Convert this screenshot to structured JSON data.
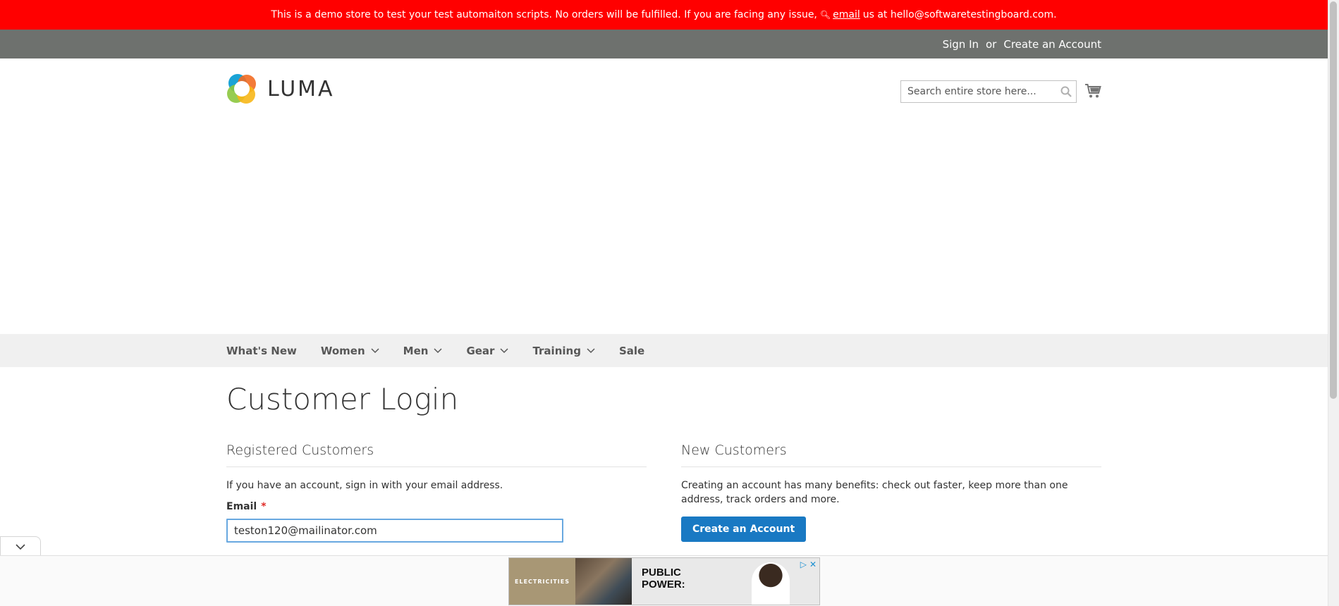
{
  "banner": {
    "text_before": "This is a demo store to test your test automaiton scripts. No orders will be fulfilled. If you are facing any issue,",
    "email_link": "email",
    "text_after": "us at hello@softwaretestingboard.com."
  },
  "header": {
    "sign_in": "Sign In",
    "or": "or",
    "create_account": "Create an Account"
  },
  "logo": {
    "text": "LUMA"
  },
  "search": {
    "placeholder": "Search entire store here..."
  },
  "nav": {
    "items": [
      {
        "label": "What's New",
        "dropdown": false
      },
      {
        "label": "Women",
        "dropdown": true
      },
      {
        "label": "Men",
        "dropdown": true
      },
      {
        "label": "Gear",
        "dropdown": true
      },
      {
        "label": "Training",
        "dropdown": true
      },
      {
        "label": "Sale",
        "dropdown": false
      }
    ]
  },
  "page": {
    "title": "Customer Login"
  },
  "registered": {
    "title": "Registered Customers",
    "intro": "If you have an account, sign in with your email address.",
    "email_label": "Email",
    "required_mark": "*",
    "email_value": "teston120@mailinator.com"
  },
  "new_customers": {
    "title": "New Customers",
    "intro": "Creating an account has many benefits: check out faster, keep more than one address, track orders and more.",
    "button": "Create an Account"
  },
  "ad": {
    "brand": "ELECTRICITIES",
    "headline_line1": "PUBLIC",
    "headline_line2": "POWER:"
  },
  "colors": {
    "banner": "#ff0000",
    "header_panel": "#6e716e",
    "nav_bg": "#f0f0f0",
    "primary_button": "#1979c3",
    "required": "#e02b27",
    "focus_border": "#68a8e0"
  }
}
